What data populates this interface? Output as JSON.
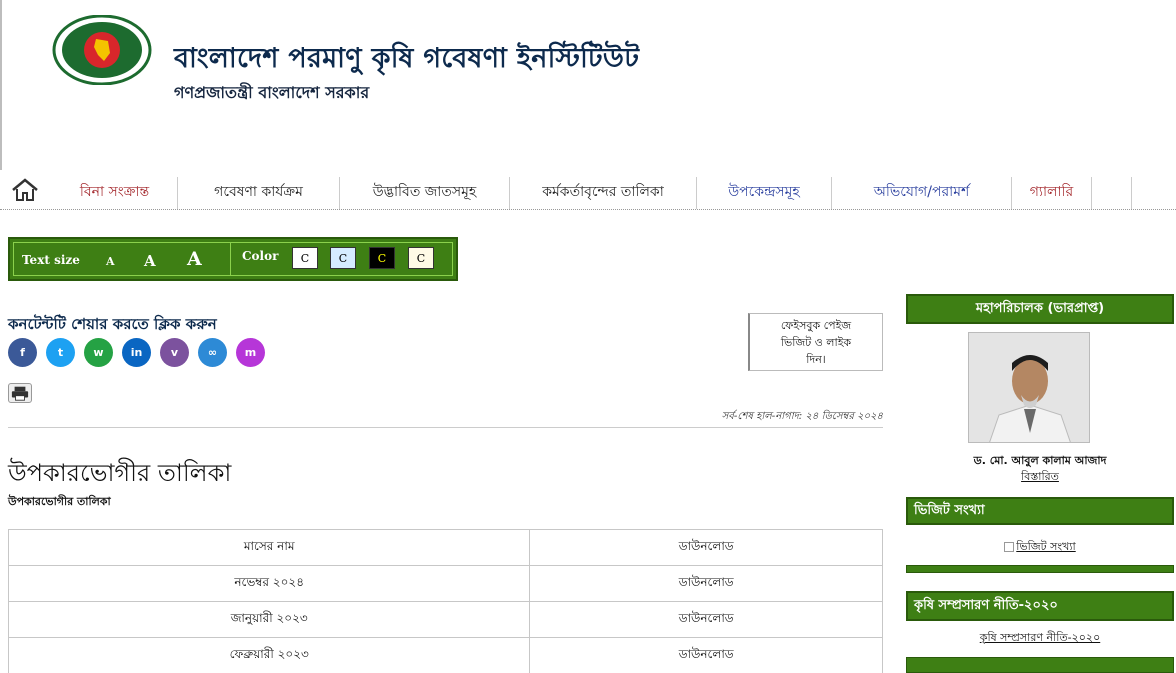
{
  "header": {
    "title": "বাংলাদেশ পরমাণু কৃষি গবেষণা ইনস্টিটিউট",
    "subtitle": "গণপ্রজাতন্ত্রী বাংলাদেশ সরকার"
  },
  "nav": {
    "home_icon": "home-icon",
    "items": [
      {
        "label": "বিনা সংক্রান্ত",
        "color": "#a3262b"
      },
      {
        "label": "গবেষণা কার্যক্রম",
        "color": "#222222"
      },
      {
        "label": "উদ্ভাবিত জাতসমূহ",
        "color": "#222222"
      },
      {
        "label": "কর্মকর্তাবৃন্দের তালিকা",
        "color": "#222222"
      },
      {
        "label": "উপকেন্দ্রসমূহ",
        "color": "#2a3f9e"
      },
      {
        "label": "অভিযোগ/পরামর্শ",
        "color": "#2a3f9e"
      },
      {
        "label": "গ্যালারি",
        "color": "#a3262b"
      }
    ]
  },
  "accessibility": {
    "text_size_label": "Text size",
    "sizes": [
      "A",
      "A",
      "A"
    ],
    "color_label": "Color",
    "color_options": [
      {
        "label": "C",
        "bg": "#ffffff",
        "fg": "#000000"
      },
      {
        "label": "C",
        "bg": "#d6ecff",
        "fg": "#000000"
      },
      {
        "label": "C",
        "bg": "#000000",
        "fg": "#ffff00"
      },
      {
        "label": "C",
        "bg": "#fffbe6",
        "fg": "#000000"
      }
    ]
  },
  "share": {
    "title": "কনটেন্টটি শেয়ার করতে ক্লিক করুন",
    "buttons": [
      {
        "icon": "facebook-icon",
        "glyph": "f",
        "color": "#3b5998"
      },
      {
        "icon": "twitter-icon",
        "glyph": "t",
        "color": "#1da1f2"
      },
      {
        "icon": "whatsapp-icon",
        "glyph": "w",
        "color": "#25a244"
      },
      {
        "icon": "linkedin-icon",
        "glyph": "in",
        "color": "#0a66c2"
      },
      {
        "icon": "viber-icon",
        "glyph": "v",
        "color": "#7c529e"
      },
      {
        "icon": "link-icon",
        "glyph": "∞",
        "color": "#2d8ad6"
      },
      {
        "icon": "messenger-icon",
        "glyph": "m",
        "color": "#b636d8"
      }
    ],
    "facebook_box": [
      "ফেইসবুক পেইজ",
      "ভিজিট ও লাইক",
      "দিন।"
    ]
  },
  "updated": "সর্ব-শেষ হাল-নাগাদ: ২৪ ডিসেম্বর ২০২৪",
  "main": {
    "title": "উপকারভোগীর তালিকা",
    "subtitle": "উপকারভোগীর তালিকা",
    "table": {
      "headers": [
        "মাসের নাম",
        "ডাউনলোড"
      ],
      "rows": [
        [
          "নভেম্বর ২০২৪",
          "ডাউনলোড"
        ],
        [
          "জানুয়ারী ২০২৩",
          "ডাউনলোড"
        ],
        [
          "ফেব্রুয়ারী ২০২৩",
          "ডাউনলোড"
        ]
      ]
    }
  },
  "sidebar": {
    "dg_title": "মহাপরিচালক (ভারপ্রাপ্ত)",
    "dg_name": "ড. মো. আবুল কালাম আজাদ",
    "dg_link": "বিস্তারিত",
    "visit_title": "ভিজিট সংখ্যা",
    "visit_image_alt": "ভিজিট সংখ্যা",
    "policy_title": "কৃষি সম্প্রসারণ নীতি-২০২০",
    "policy_link": "কৃষি সম্প্রসারণ নীতি-২০২০"
  },
  "colors": {
    "green": "#3e7f14",
    "navy": "#0d2a4d"
  }
}
